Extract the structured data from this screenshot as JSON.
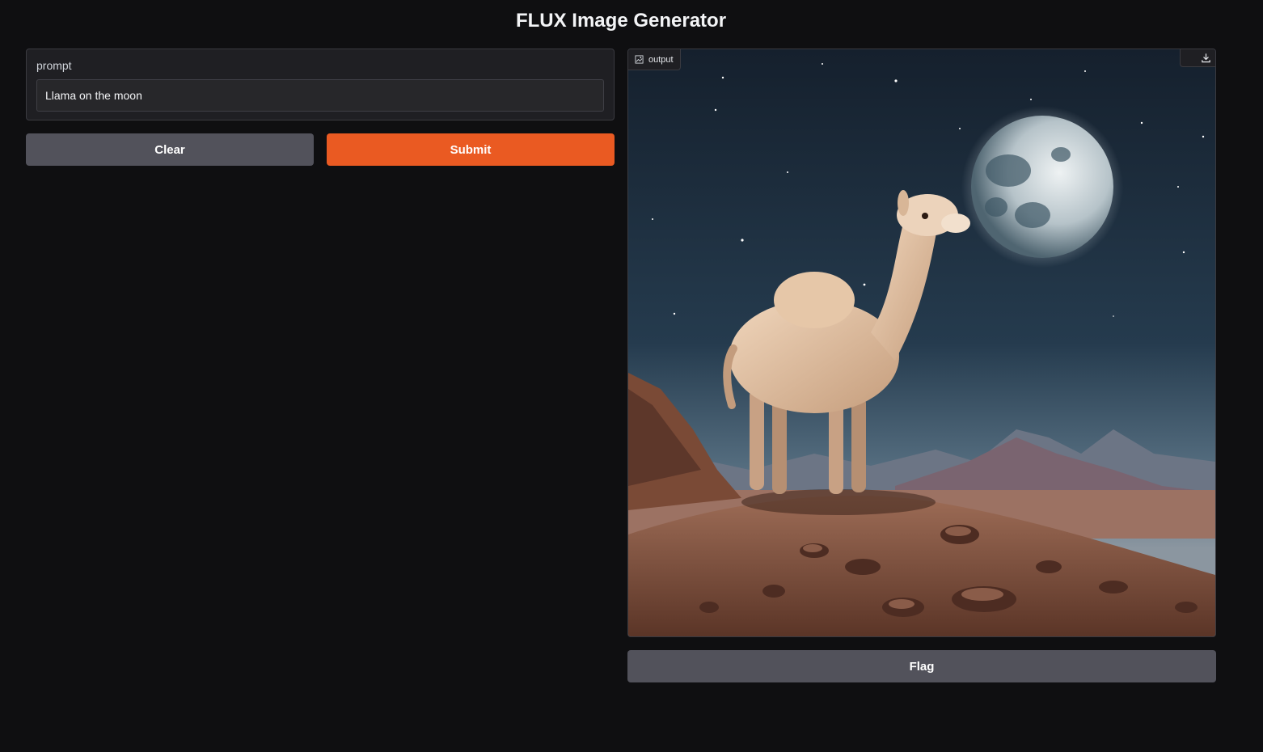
{
  "app": {
    "title": "FLUX Image Generator"
  },
  "prompt": {
    "label": "prompt",
    "value": "Llama on the moon"
  },
  "actions": {
    "clear_label": "Clear",
    "submit_label": "Submit",
    "flag_label": "Flag"
  },
  "output": {
    "label": "output",
    "label_icon": "image-icon",
    "download_icon": "download-icon"
  },
  "colors": {
    "background": "#0f0f11",
    "panel": "#1f1f23",
    "primary": "#ea5a22",
    "secondary": "#52525b"
  }
}
